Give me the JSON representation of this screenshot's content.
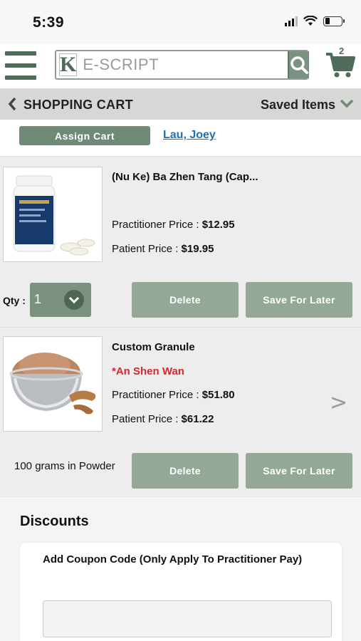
{
  "status_bar": {
    "time": "5:39"
  },
  "nav": {
    "logo_letter": "K",
    "search_placeholder": "E-SCRIPT",
    "cart_count": "2"
  },
  "cart_header": {
    "title": "SHOPPING CART",
    "saved_items": "Saved Items"
  },
  "assign": {
    "button_label": "Assign Cart",
    "patient_name": "Lau, Joey"
  },
  "items": [
    {
      "name": "(Nu Ke) Ba Zhen Tang (Cap...",
      "image": "supplement-bottle-image",
      "practitioner_label": "Practitioner Price : ",
      "practitioner_price": "$12.95",
      "patient_label": "Patient Price : ",
      "patient_price": "$19.95",
      "qty_label": "Qty :",
      "qty_value": "1",
      "delete_label": "Delete",
      "save_later_label": "Save For Later"
    },
    {
      "name": "Custom Granule",
      "subtitle": "*An Shen Wan",
      "image": "herbal-powder-bowl-image",
      "practitioner_label": "Practitioner Price : ",
      "practitioner_price": "$51.80",
      "patient_label": "Patient Price : ",
      "patient_price": "$61.22",
      "form_text": "100 grams in Powder",
      "delete_label": "Delete",
      "save_later_label": "Save For Later"
    }
  ],
  "discounts": {
    "title": "Discounts",
    "coupon_label": "Add Coupon Code (Only Apply To Practitioner Pay)"
  },
  "colors": {
    "brand_green": "#6f8a76",
    "button_green": "#94a898",
    "link_blue": "#1d6fb8",
    "alert_red": "#d8262a"
  }
}
